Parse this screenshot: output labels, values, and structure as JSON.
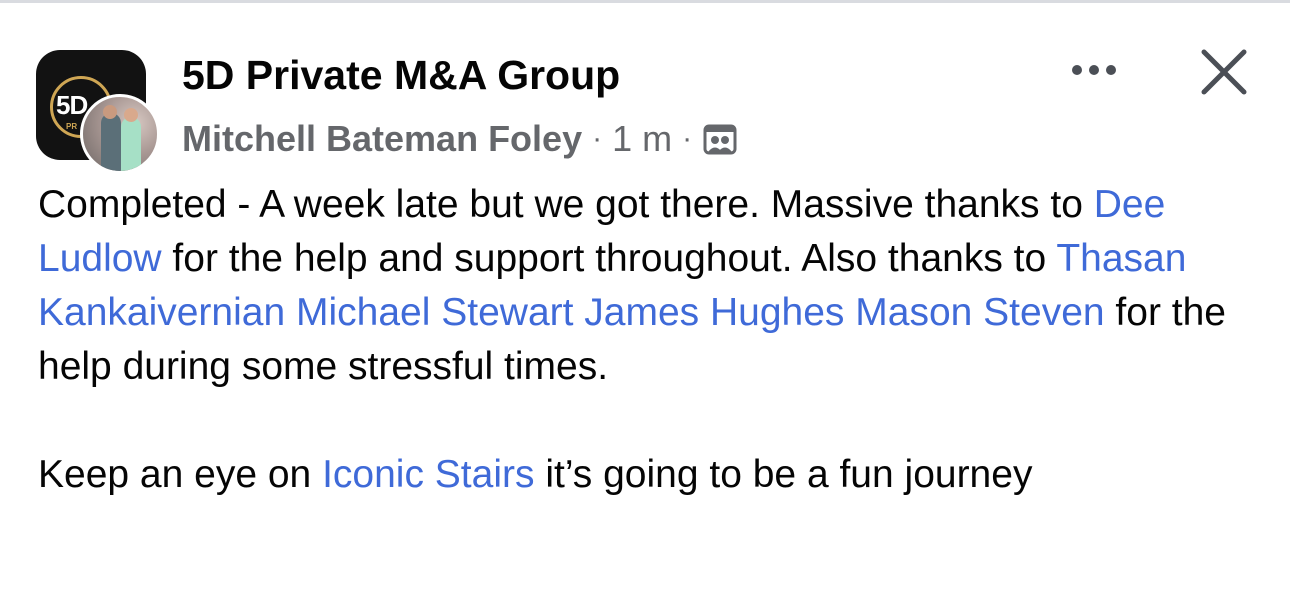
{
  "post": {
    "group_name": "5D Private M&A Group",
    "author": "Mitchell Bateman Foley",
    "separator": "·",
    "time": "1 m",
    "group_avatar": {
      "logo_text": "5D",
      "logo_sub": "PR"
    },
    "body": {
      "p1_text_1": "Completed - A week late but we got there. Massive thanks to ",
      "mention_1": "Dee Ludlow",
      "p1_text_2": " for the help and support throughout. Also thanks to ",
      "mention_2": "Thasan Kankaivernian",
      "space_a": " ",
      "mention_3": "Michael Stewart",
      "space_b": " ",
      "mention_4": "James Hughes",
      "space_c": " ",
      "mention_5": "Mason Steven",
      "p1_text_3": " for the help during some stressful times.",
      "p2_text_1": "Keep an eye on ",
      "mention_6": "Iconic Stairs",
      "p2_text_2": " it’s going to be a fun journey"
    }
  },
  "icons": {
    "more": "more-options-icon",
    "close": "close-icon",
    "privacy": "group-members-icon"
  },
  "colors": {
    "text": "#050505",
    "secondary": "#65676b",
    "mention": "#3f6ad8",
    "logo_gold": "#cfa654"
  }
}
